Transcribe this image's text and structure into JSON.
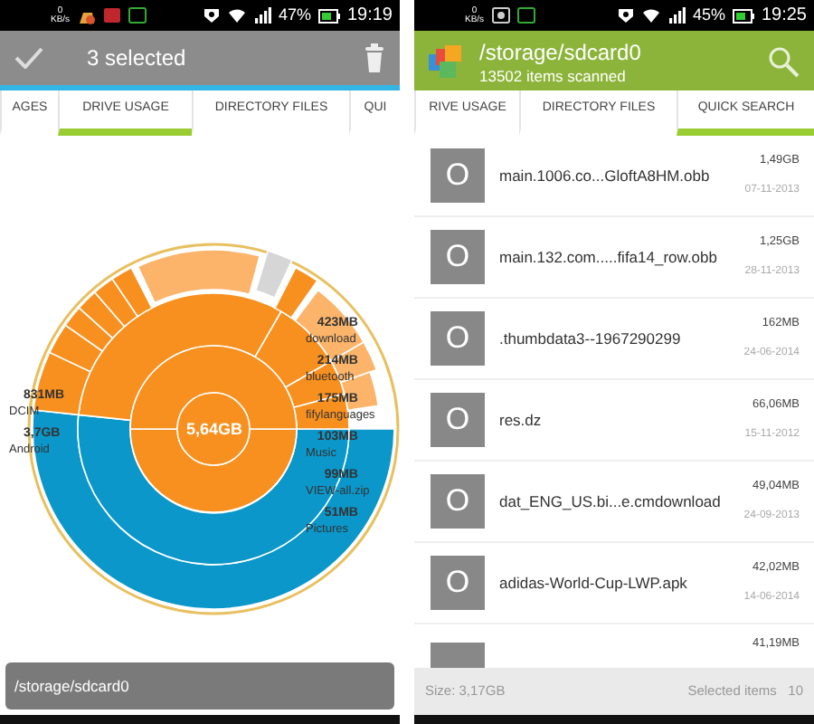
{
  "screens": [
    {
      "kind": "usage",
      "status_bar": {
        "speed": "0",
        "speed_unit": "KB/s",
        "battery": "47%",
        "time": "19:19"
      },
      "app_bar": {
        "title": "3 selected"
      },
      "tabs": [
        {
          "label": "AGES",
          "selected": false
        },
        {
          "label": "DRIVE USAGE",
          "selected": true
        },
        {
          "label": "DIRECTORY FILES",
          "selected": false
        },
        {
          "label": "QUI",
          "selected": false
        }
      ],
      "center_label": "5,64GB",
      "left_labels": [
        {
          "size": "831MB",
          "name": "DCIM"
        },
        {
          "size": "3,7GB",
          "name": "Android"
        }
      ],
      "right_labels": [
        {
          "size": "423MB",
          "name": "download"
        },
        {
          "size": "214MB",
          "name": "bluetooth"
        },
        {
          "size": "175MB",
          "name": "fifylanguages"
        },
        {
          "size": "103MB",
          "name": "Music"
        },
        {
          "size": "99MB",
          "name": "VIEW-all.zip"
        },
        {
          "size": "51MB",
          "name": "Pictures"
        }
      ],
      "path_bar": "/storage/sdcard0"
    },
    {
      "kind": "search",
      "status_bar": {
        "speed": "0",
        "speed_unit": "KB/s",
        "battery": "45%",
        "time": "19:25"
      },
      "app_bar": {
        "title": "/storage/sdcard0",
        "subtitle": "13502 items scanned"
      },
      "tabs": [
        {
          "label": "RIVE USAGE",
          "selected": false
        },
        {
          "label": "DIRECTORY FILES",
          "selected": false
        },
        {
          "label": "QUICK SEARCH",
          "selected": true
        }
      ],
      "files": [
        {
          "thumb": "O",
          "name": "main.1006.co...GloftA8HM.obb",
          "size": "1,49GB",
          "date": "07-11-2013"
        },
        {
          "thumb": "O",
          "name": "main.132.com.....fifa14_row.obb",
          "size": "1,25GB",
          "date": "28-11-2013"
        },
        {
          "thumb": "O",
          "name": ".thumbdata3--1967290299",
          "size": "162MB",
          "date": "24-06-2014"
        },
        {
          "thumb": "O",
          "name": "res.dz",
          "size": "66,06MB",
          "date": "15-11-2012"
        },
        {
          "thumb": "O",
          "name": "dat_ENG_US.bi...e.cmdownload",
          "size": "49,04MB",
          "date": "24-09-2013"
        },
        {
          "thumb": "O",
          "name": "adidas-World-Cup-LWP.apk",
          "size": "42,02MB",
          "date": "14-06-2014"
        },
        {
          "size": "41,19MB"
        }
      ],
      "footer": {
        "size": "Size: 3,17GB",
        "selected_label": "Selected items",
        "selected_count": "10"
      }
    }
  ]
}
